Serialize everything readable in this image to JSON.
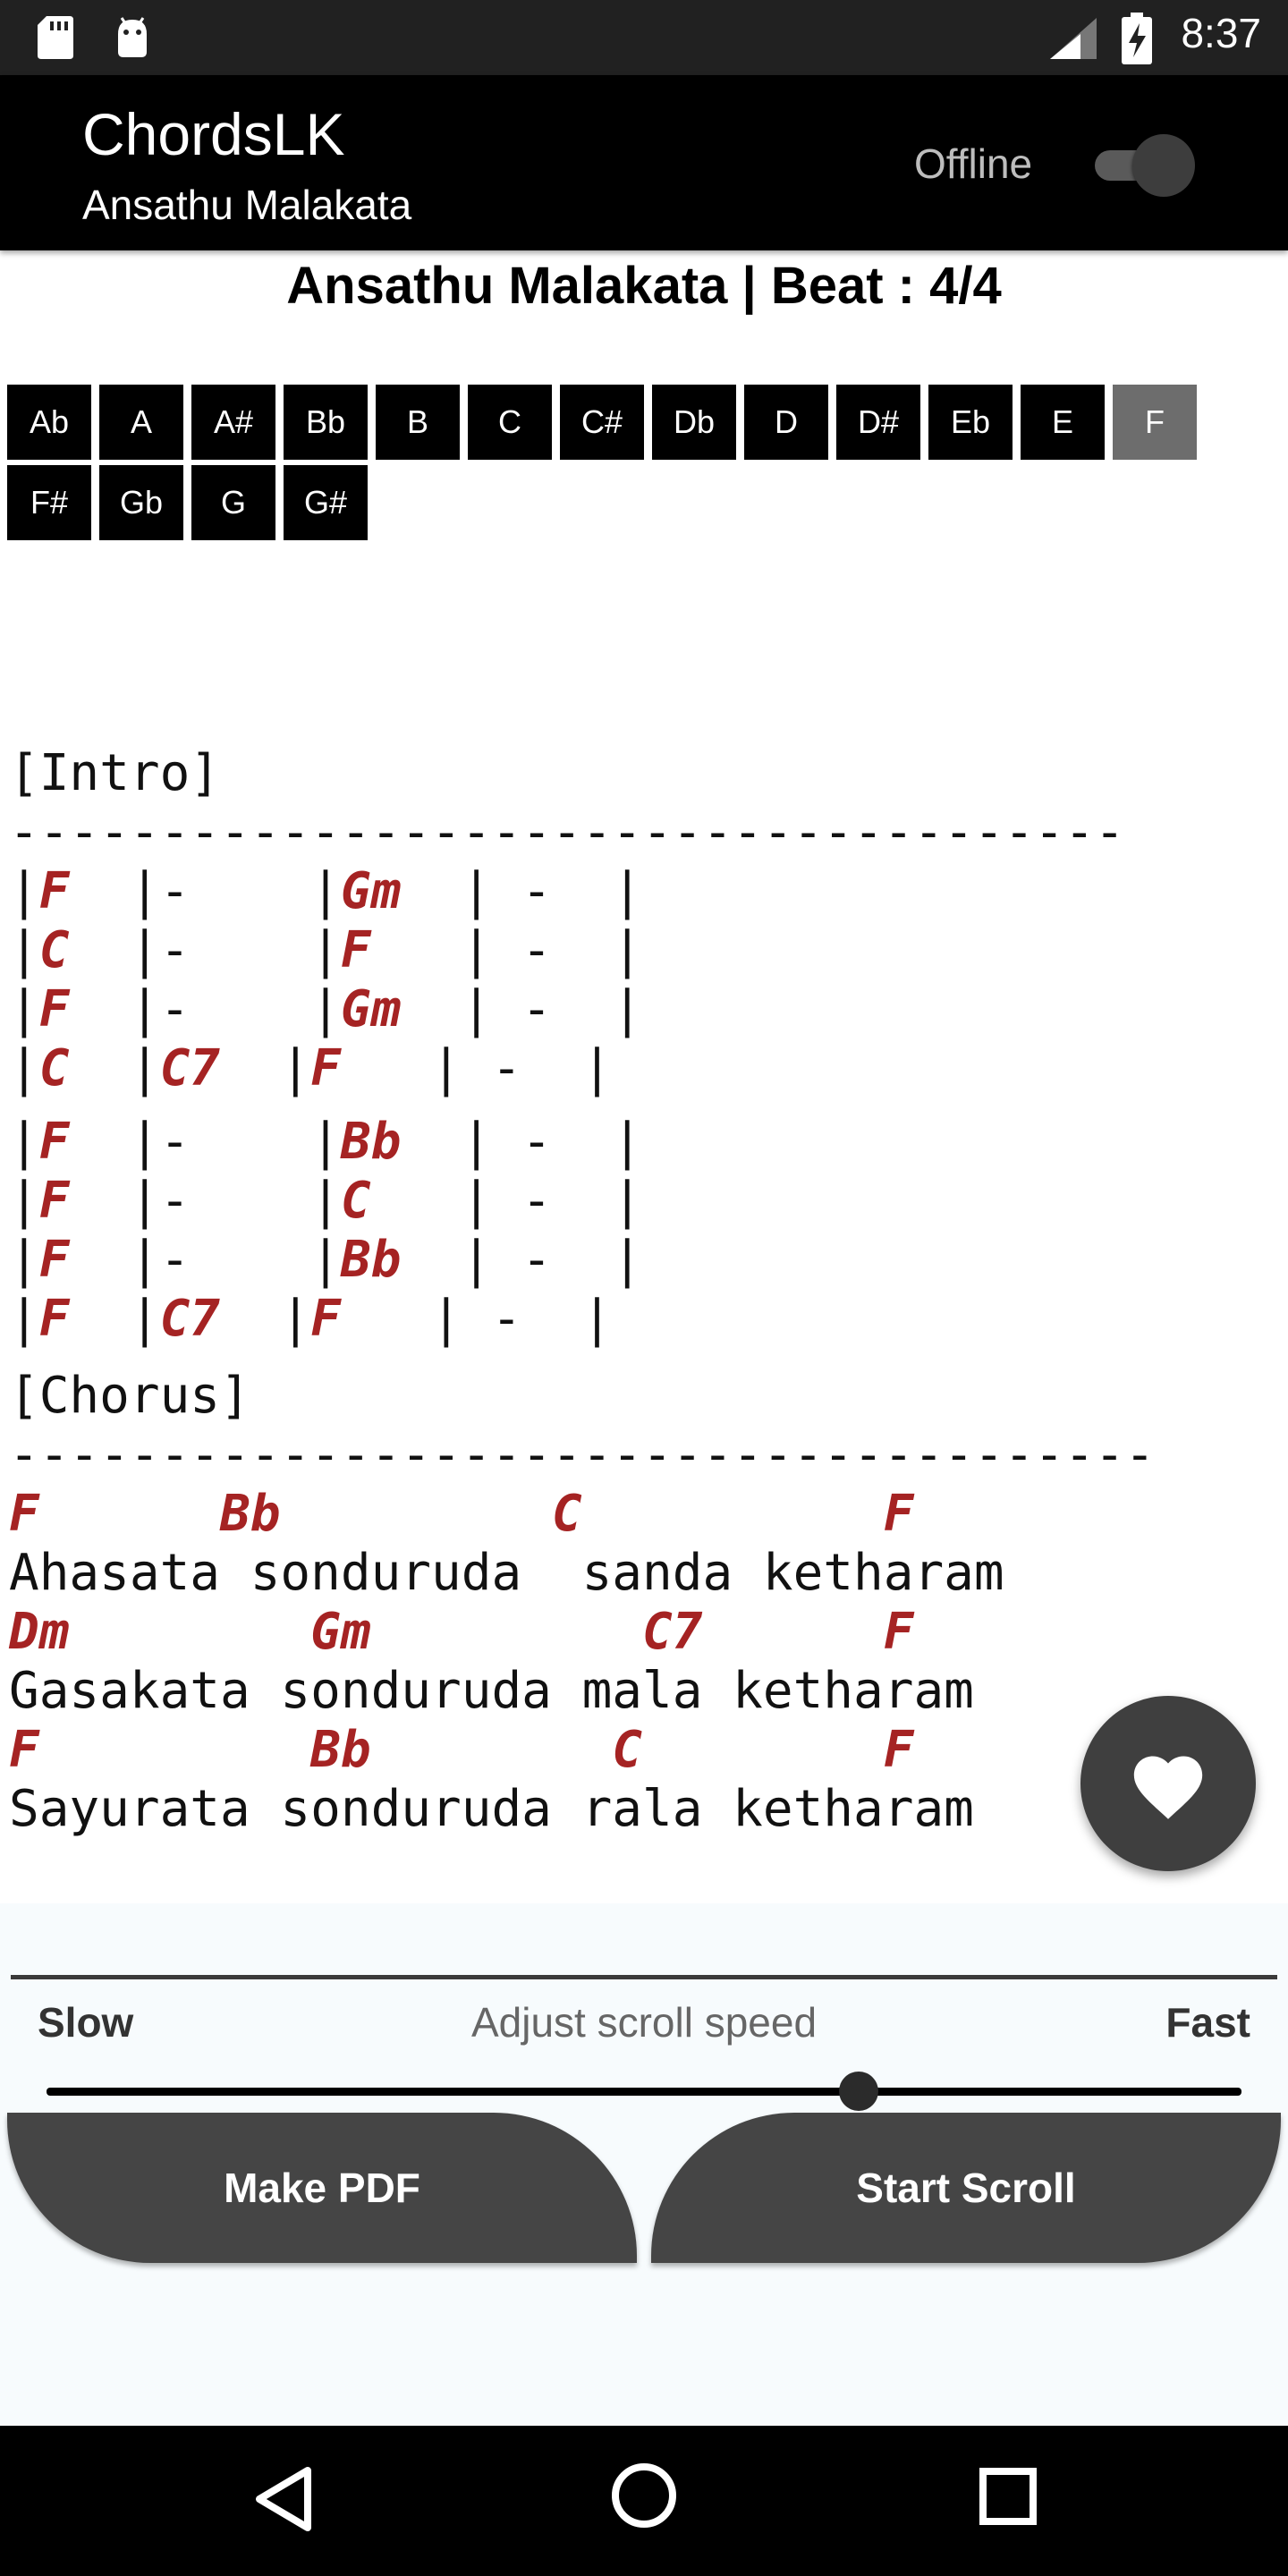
{
  "status_bar": {
    "time": "8:37",
    "icons": [
      "sd-card-icon",
      "android-icon",
      "signal-icon",
      "battery-charging-icon"
    ]
  },
  "app_bar": {
    "title": "ChordsLK",
    "subtitle": "Ansathu Malakata",
    "offline_label": "Offline",
    "offline_enabled": false
  },
  "song": {
    "heading": "Ansathu Malakata | Beat : 4/4"
  },
  "keys": {
    "row1": [
      "Ab",
      "A",
      "A#",
      "Bb",
      "B",
      "C",
      "C#",
      "Db",
      "D",
      "D#",
      "Eb",
      "E",
      "F"
    ],
    "row2": [
      "F#",
      "Gb",
      "G",
      "G#"
    ],
    "selected": "F"
  },
  "sheet": {
    "intro_header": "[Intro]",
    "intro_rule": "-------------------------------------",
    "intro_block1": [
      [
        "|",
        "F",
        "  |-    |",
        "Gm",
        "  | -  |"
      ],
      [
        "|",
        "C",
        "  |-    |",
        "F",
        "   | -  |"
      ],
      [
        "|",
        "F",
        "  |-    |",
        "Gm",
        "  | -  |"
      ],
      [
        "|",
        "C",
        "  |",
        "C7",
        "  |",
        "F",
        "   | -  |"
      ]
    ],
    "intro_block2": [
      [
        "|",
        "F",
        "  |-    |",
        "Bb",
        "  | -  |"
      ],
      [
        "|",
        "F",
        "  |-    |",
        "C",
        "   | -  |"
      ],
      [
        "|",
        "F",
        "  |-    |",
        "Bb",
        "  | -  |"
      ],
      [
        "|",
        "F",
        "  |",
        "C7",
        "  |",
        "F",
        "   | -  |"
      ]
    ],
    "chorus_header": "[Chorus]",
    "chorus_rule": "--------------------------------------",
    "chorus": [
      {
        "chords": "F      Bb         C          F",
        "lyric": "Ahasata sonduruda  sanda ketharam"
      },
      {
        "chords": "Dm        Gm         C7      F",
        "lyric": "Gasakata sonduruda mala ketharam"
      },
      {
        "chords": "F         Bb        C        F",
        "lyric": "Sayurata sonduruda rala ketharam"
      }
    ]
  },
  "controls": {
    "slow_label": "Slow",
    "fast_label": "Fast",
    "caption": "Adjust scroll speed",
    "scroll_speed": 0.68,
    "make_pdf_label": "Make PDF",
    "start_scroll_label": "Start Scroll"
  },
  "colors": {
    "chord": "#a52323",
    "selected_key": "#6d6d6d",
    "key": "#000000"
  }
}
